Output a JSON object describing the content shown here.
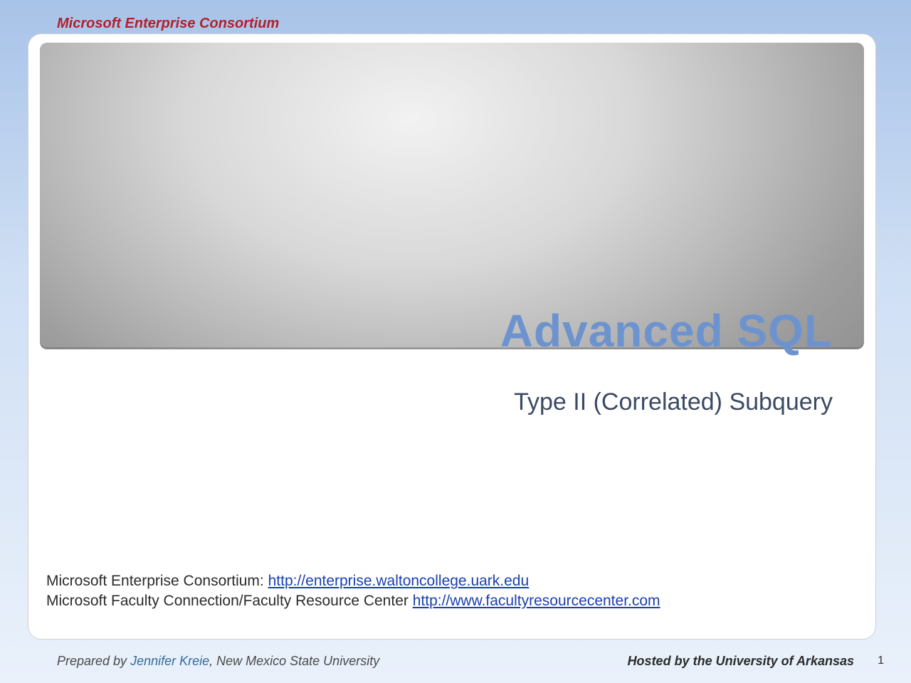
{
  "header": {
    "org": "Microsoft Enterprise Consortium"
  },
  "slide": {
    "title": "Advanced SQL",
    "subtitle": "Type II (Correlated) Subquery"
  },
  "refs": {
    "line1_prefix": "Microsoft Enterprise Consortium: ",
    "line1_link": "http://enterprise.waltoncollege.uark.edu",
    "line2_prefix": "Microsoft Faculty Connection/Faculty Resource Center ",
    "line2_link": "http://www.facultyresourcecenter.com"
  },
  "footer": {
    "prepared_prefix": "Prepared by ",
    "author": "Jennifer Kreie",
    "prepared_suffix": ", New Mexico State University",
    "hosted": "Hosted by the University of Arkansas",
    "page": "1"
  }
}
